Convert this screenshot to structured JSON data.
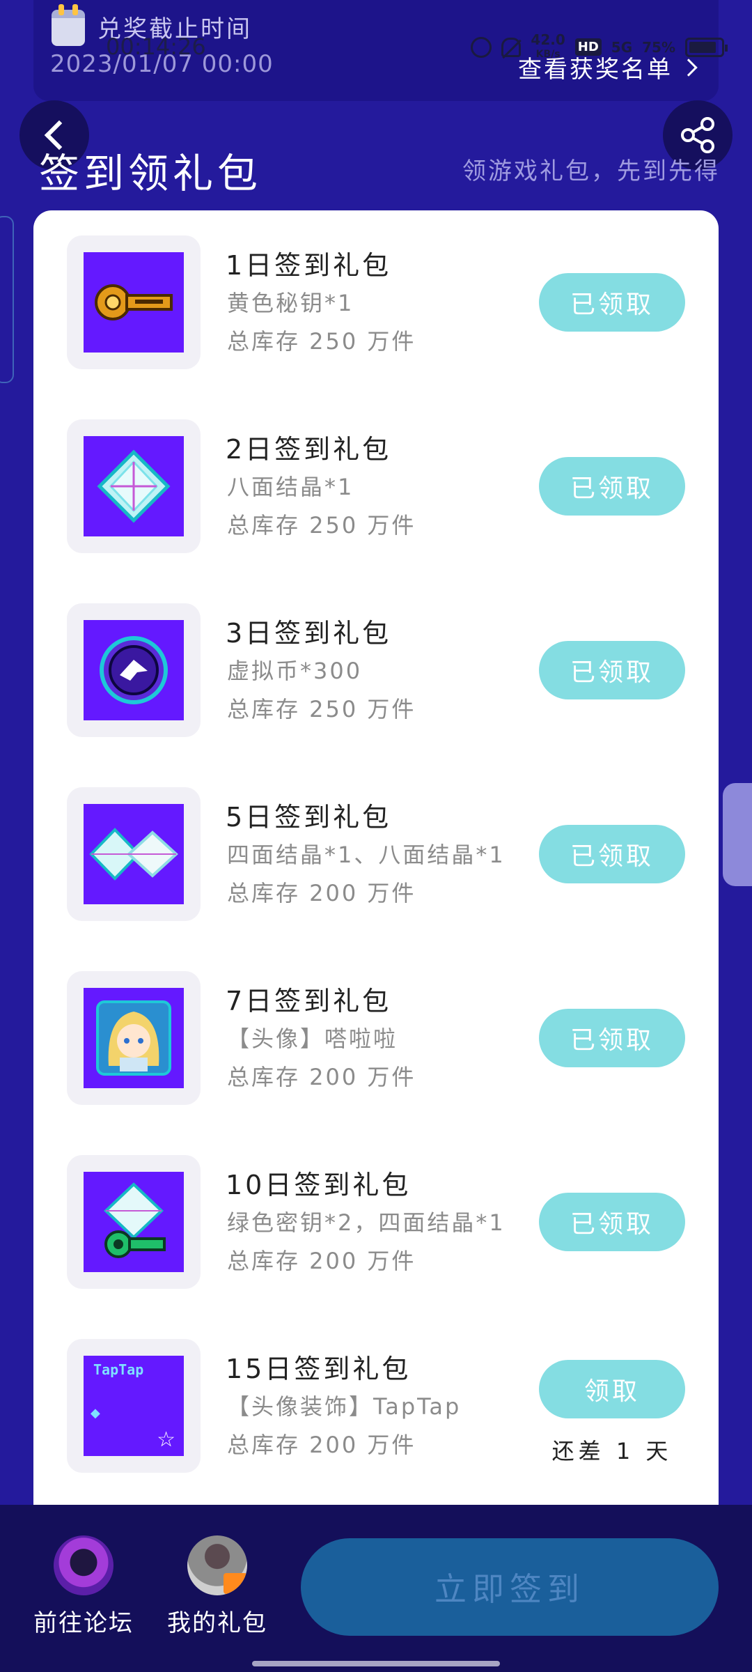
{
  "status_bar": {
    "time": "00:14:26",
    "net_speed": "42.0",
    "net_unit": "KB/s",
    "hd_label": "HD",
    "signal": "5G",
    "battery": "75%"
  },
  "banner": {
    "deadline_label": "兑奖截止时间",
    "deadline": "2023/01/07 00:00",
    "winners_link": "查看获奖名单"
  },
  "header": {
    "title": "签到领礼包",
    "subtitle": "领游戏礼包，先到先得"
  },
  "gifts": [
    {
      "title": "1日签到礼包",
      "items": "黄色秘钥*1",
      "stock": "总库存 250 万件",
      "button": "已领取"
    },
    {
      "title": "2日签到礼包",
      "items": "八面结晶*1",
      "stock": "总库存 250 万件",
      "button": "已领取"
    },
    {
      "title": "3日签到礼包",
      "items": "虚拟币*300",
      "stock": "总库存 250 万件",
      "button": "已领取"
    },
    {
      "title": "5日签到礼包",
      "items": "四面结晶*1、八面结晶*1",
      "stock": "总库存 200 万件",
      "button": "已领取"
    },
    {
      "title": "7日签到礼包",
      "items": "【头像】嗒啦啦",
      "stock": "总库存 200 万件",
      "button": "已领取"
    },
    {
      "title": "10日签到礼包",
      "items": "绿色密钥*2，四面结晶*1",
      "stock": "总库存 200 万件",
      "button": "已领取"
    },
    {
      "title": "15日签到礼包",
      "items": "【头像装饰】TapTap",
      "stock": "总库存 200 万件",
      "button": "领取",
      "remaining": "还差 1 天"
    }
  ],
  "thumb_text": {
    "taptap": "TapTap"
  },
  "bottom_bar": {
    "forum_label": "前往论坛",
    "my_gifts_label": "我的礼包",
    "signin_button": "立即签到"
  },
  "colors": {
    "background": "#241a9c",
    "accent_button": "#84dde2",
    "signin_button": "#1a5f9b",
    "thumb_bg": "#6419ff"
  }
}
